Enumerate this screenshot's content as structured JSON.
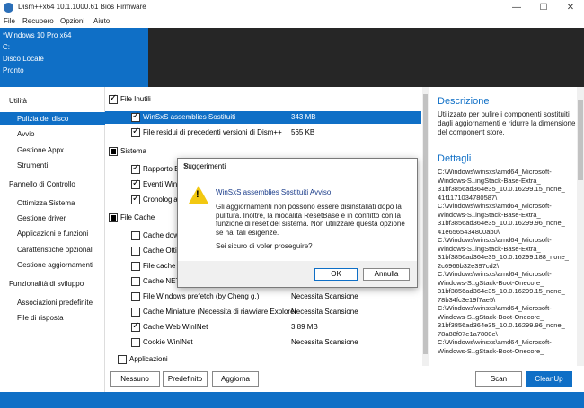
{
  "window": {
    "title": "Dism++x64 10.1.1000.61 Bios Firmware",
    "minimize": "—",
    "maximize": "☐",
    "close": "✕"
  },
  "menu": [
    "File",
    "Recupero",
    "Opzioni",
    "Aiuto"
  ],
  "info": {
    "os": "*Windows 10 Pro x64",
    "drive": "C:",
    "disk": "Disco Locale",
    "status": "Pronto"
  },
  "sidebar": {
    "groups": [
      {
        "label": "Utilità",
        "items": [
          "Pulizia del disco",
          "Avvio",
          "Gestione Appx",
          "Strumenti"
        ]
      },
      {
        "label": "Pannello di Controllo",
        "items": [
          "Ottimizza Sistema",
          "Gestione driver",
          "Applicazioni e funzioni",
          "Caratteristiche opzionali",
          "Gestione aggiornamenti"
        ]
      },
      {
        "label": "Funzionalità di sviluppo",
        "items": [
          "Associazioni predefinite",
          "File di risposta"
        ]
      }
    ]
  },
  "list": [
    {
      "label": "File Inutili",
      "value": ""
    },
    {
      "label": "WinSxS assemblies Sostituiti",
      "value": "343 MB"
    },
    {
      "label": "File residui di precedenti versioni di Dism++",
      "value": "565 KB"
    },
    {
      "label": "Sistema",
      "value": ""
    },
    {
      "label": "Rapporto E",
      "value": ""
    },
    {
      "label": "Eventi Win",
      "value": ""
    },
    {
      "label": "Cronologia",
      "value": ""
    },
    {
      "label": "File Cache",
      "value": ""
    },
    {
      "label": "Cache dow",
      "value": ""
    },
    {
      "label": "Cache Otti",
      "value": ""
    },
    {
      "label": "File cache I",
      "value": ""
    },
    {
      "label": "Cache NET",
      "value": ""
    },
    {
      "label": "File Windows prefetch (by Cheng g.)",
      "value": "Necessita Scansione"
    },
    {
      "label": "Cache Miniature (Necessita di riavviare Explorer",
      "value": "Necessita Scansione"
    },
    {
      "label": "Cache Web WinINet",
      "value": "3,89 MB"
    },
    {
      "label": "Cookie WinINet",
      "value": "Necessita Scansione"
    },
    {
      "label": "Applicazioni",
      "value": ""
    }
  ],
  "buttons": {
    "nessuno": "Nessuno",
    "predefinito": "Predefinito",
    "aggiorna": "Aggiorna",
    "scan": "Scan",
    "cleanup": "CleanUp"
  },
  "right": {
    "desc_title": "Descrizione",
    "desc": "Utilizzato per pulire i componenti sostituiti dagli aggiornamenti e ridurre la dimensione del component store.",
    "det_title": "Dettagli",
    "details": "C:\\Windows\\winsxs\\amd64_Microsoft-\nWindows-S..ingStack-Base-Extra_\n31bf3856ad364e35_10.0.16299.15_none_\n41f1171034780587\\\nC:\\Windows\\winsxs\\amd64_Microsoft-\nWindows-S..ingStack-Base-Extra_\n31bf3856ad364e35_10.0.16299.96_none_\n41e6565434800ab0\\\nC:\\Windows\\winsxs\\amd64_Microsoft-\nWindows-S..ingStack-Base-Extra_\n31bf3856ad364e35_10.0.16299.188_none_\n2c6966b32e397cd2\\\nC:\\Windows\\winsxs\\amd64_Microsoft-\nWindows-S..gStack-Boot-Onecore_\n31bf3856ad364e35_10.0.16299.15_none_\n78b34fc3e19f7ae5\\\nC:\\Windows\\winsxs\\amd64_Microsoft-\nWindows-S..gStack-Boot-Onecore_\n31bf3856ad364e35_10.0.16299.96_none_\n78a88f07e1a7800e\\\nC:\\Windows\\winsxs\\amd64_Microsoft-\nWindows-S..gStack-Boot-Onecore_"
  },
  "dialog": {
    "title": "Suggerimenti",
    "heading": "WinSxS assemblies Sostituiti Avviso:",
    "message": "Gli aggiornamenti non possono essere disinstallati dopo la pulitura. Inoltre, la modalità ResetBase è in conflitto con la funzione di reset del sistema. Non utilizzare questa opzione se hai tali esigenze.",
    "question": "Sei sicuro di voler proseguire?",
    "ok": "OK",
    "cancel": "Annulla"
  },
  "colors": {
    "accent": "#0f6fc6",
    "dark": "#262626",
    "warning": "#f2c811"
  }
}
